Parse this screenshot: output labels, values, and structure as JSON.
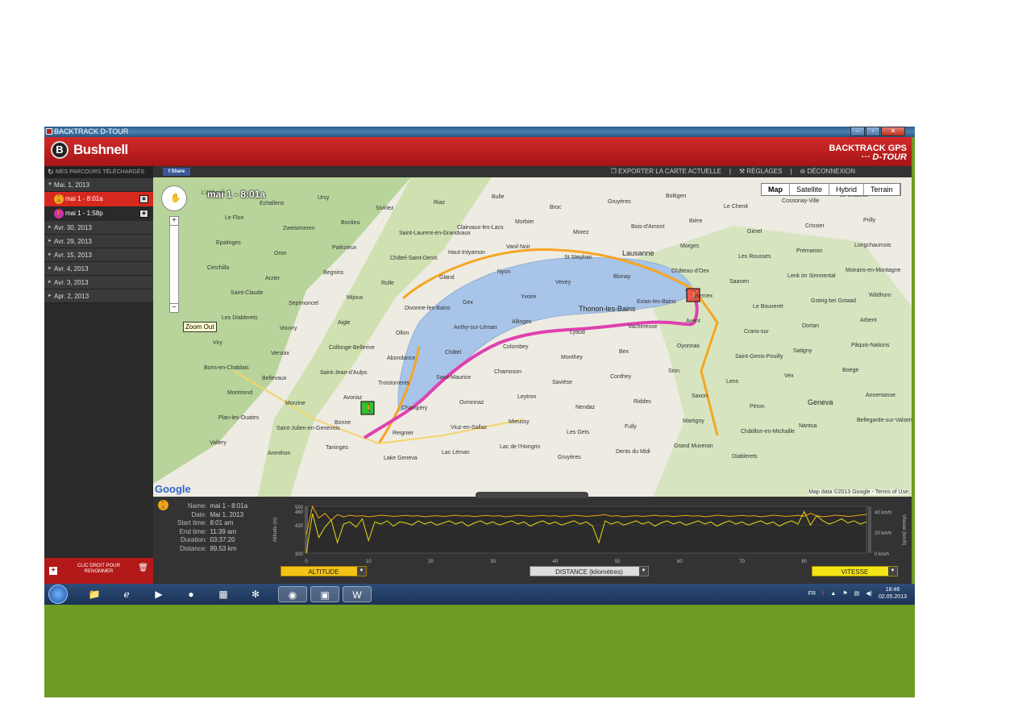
{
  "window": {
    "title": "BACKTRACK D-TOUR"
  },
  "header": {
    "brand": "Bushnell",
    "logo_letter": "B",
    "product_line1": "BACKTRACK GPS",
    "product_line2": "··· D-TOUR"
  },
  "sidebar": {
    "title": "MES PARCOURS TÉLÉCHARGÉS",
    "open_date": "Mai. 1, 2013",
    "tracks": [
      {
        "label": "mai 1 - 8:01a",
        "selected": true,
        "icon_color": "#f3a517"
      },
      {
        "label": "mai 1 - 1:58p",
        "selected": false,
        "icon_color": "#d42fa5"
      }
    ],
    "dates": [
      "Avr. 30, 2013",
      "Avr. 29, 2013",
      "Avr. 15, 2013",
      "Avr. 4, 2013",
      "Avr. 3, 2013",
      "Apr. 2, 2013"
    ],
    "footer_line1": "CLIC DROIT POUR",
    "footer_line2": "RENOMMER"
  },
  "toolbar": {
    "share": "f Share",
    "export": "EXPORTER LA CARTE ACTUELLE",
    "settings": "RÉGLAGES",
    "logout": "DÉCONNEXION"
  },
  "map": {
    "track_name": "mai 1 - 8:01a",
    "types": [
      "Map",
      "Satellite",
      "Hybrid",
      "Terrain"
    ],
    "active_type": "Map",
    "zoom_tooltip": "Zoom Out",
    "google": "Google",
    "attribution": "Map data ©2013 Google - Terms of Use",
    "labels": [
      "L'Abbaye",
      "Echallens",
      "Ursy",
      "Siviriez",
      "Riaz",
      "Bulle",
      "Broc",
      "Gruyères",
      "Boltigen",
      "Le Chenit",
      "Cossonay-Ville",
      "Le Brassus",
      "Le Flon",
      "Zweisimmen",
      "Bonlieu",
      "Saint-Laurent-en-Grandvaux",
      "Clairvaux-les-Lacs",
      "Morbier",
      "Morez",
      "Bois-d'Amont",
      "Bière",
      "Gimel",
      "Crissier",
      "Prilly",
      "Epalinges",
      "Oron",
      "Palézieux",
      "Châtel-Saint-Denis",
      "Haut-Intyamon",
      "Vanil Noir",
      "St Stephan",
      "Lausanne",
      "Morges",
      "Les Rousses",
      "Prémanon",
      "Longchaumois",
      "Cerchilla",
      "Arzier",
      "Begnins",
      "Rolle",
      "Gland",
      "Nyon",
      "Vevey",
      "Blonay",
      "Château-d'Oex",
      "Saanen",
      "Lenk im Simmental",
      "Moirans-en-Montagne",
      "Saint-Claude",
      "Septmoncel",
      "Mijoux",
      "Divonne-les-Bains",
      "Gex",
      "Yvoire",
      "Thonon-les-Bains",
      "Evian-les-Bains",
      "Bernex",
      "Le Bouveret",
      "Gsteig bei Gstaad",
      "Wildhorn",
      "Les Diablerets",
      "Vouvry",
      "Aigle",
      "Ollon",
      "Anthy-sur-Léman",
      "Allinges",
      "Lyaud",
      "Vacheresse",
      "Ayent",
      "Crans-sur",
      "Dortan",
      "Arbent",
      "Viry",
      "Versoix",
      "Collonge-Bellerive",
      "Abondance",
      "Châtel",
      "Colombey",
      "Monthey",
      "Bex",
      "Oyonnax",
      "Saint-Genis-Pouilly",
      "Satigny",
      "Pâquis-Nations",
      "Bons-en-Chablais",
      "Bellevaux",
      "Saint-Jean-d'Aulps",
      "Troistorrents",
      "Saint-Maurice",
      "Chamoson",
      "Savièse",
      "Conthey",
      "Sion",
      "Lens",
      "Vex",
      "Boëge",
      "Montriond",
      "Morzine",
      "Avoriaz",
      "Champéry",
      "Ovronnaz",
      "Leytron",
      "Nendaz",
      "Riddes",
      "Saxon",
      "Péron",
      "Geneva",
      "Annemasse",
      "Plan-les-Ouates",
      "Saint-Julien-en-Genevois",
      "Bonne",
      "Reignier",
      "Viuz-en-Sallaz",
      "Mieussy",
      "Les Gets",
      "Fully",
      "Martigny",
      "Châtillon-en-Michaille",
      "Nantua",
      "Bellegarde-sur-Valserine",
      "Vallery",
      "Arenthon",
      "Taninges",
      "Lake Geneva",
      "Lac Léman",
      "Lac de l'Hongrin",
      "Gruyères",
      "Dents du Midi",
      "Grand Muveran",
      "Diablerets"
    ]
  },
  "info": {
    "name_k": "Name:",
    "name_v": "mai 1 - 8:01a",
    "date_k": "Date:",
    "date_v": "Mai 1, 2013",
    "start_k": "Start time:",
    "start_v": "8:01 am",
    "end_k": "End time:",
    "end_v": "11:39 am",
    "dur_k": "Duration:",
    "dur_v": "03:37:20",
    "dist_k": "Distance:",
    "dist_v": "89.53 km"
  },
  "chart_data": {
    "type": "line",
    "xlabel": "",
    "ylabel": "Altitude (m)",
    "y2label": "Vitesse (km/h)",
    "xlim": [
      0,
      90
    ],
    "x_ticks": [
      "0",
      "10",
      "20",
      "30",
      "40",
      "50",
      "60",
      "70",
      "80"
    ],
    "y_ticks": [
      "300",
      "420",
      "480",
      "500"
    ],
    "y2_ticks": [
      "0 km/h",
      "20 km/h",
      "40 km/h"
    ],
    "series": [
      {
        "name": "Altitude",
        "color": "#f3a517",
        "values": [
          380,
          500,
          450,
          470,
          440,
          465,
          455,
          462,
          458,
          460,
          455,
          458,
          462,
          460,
          457,
          459,
          461,
          458,
          460,
          455,
          458,
          460,
          457,
          459,
          462,
          458,
          460,
          456,
          459,
          461,
          458,
          460,
          455,
          458,
          462,
          460,
          457,
          459,
          461,
          458,
          460,
          455,
          458,
          462,
          460,
          457,
          459,
          461,
          465,
          458,
          460,
          455,
          458,
          460,
          457,
          459,
          462,
          458,
          460,
          456,
          459,
          461,
          458,
          460,
          455,
          458,
          462,
          460,
          457,
          459,
          461,
          458,
          460,
          455,
          458,
          462,
          460,
          457,
          459,
          461,
          458,
          470,
          460,
          455,
          458,
          462,
          460,
          457,
          459,
          463,
          465
        ]
      },
      {
        "name": "Vitesse",
        "color": "#e7d813",
        "values": [
          0,
          38,
          15,
          25,
          32,
          10,
          28,
          30,
          25,
          33,
          12,
          30,
          28,
          31,
          26,
          30,
          29,
          27,
          31,
          28,
          30,
          27,
          29,
          31,
          28,
          30,
          26,
          29,
          31,
          28,
          30,
          27,
          29,
          31,
          28,
          30,
          26,
          29,
          31,
          28,
          30,
          27,
          29,
          31,
          28,
          30,
          26,
          10,
          31,
          28,
          30,
          27,
          29,
          31,
          28,
          30,
          26,
          29,
          31,
          28,
          30,
          27,
          29,
          31,
          28,
          30,
          26,
          29,
          31,
          28,
          30,
          27,
          29,
          31,
          28,
          30,
          26,
          29,
          31,
          28,
          40,
          27,
          36,
          31,
          28,
          30,
          33,
          29,
          31,
          28,
          30
        ]
      }
    ]
  },
  "chart_buttons": {
    "altitude": "ALTITUDE",
    "distance": "DISTANCE (kilomètres)",
    "speed": "VITESSE"
  },
  "taskbar": {
    "apps": [
      "explorer",
      "ie",
      "media",
      "firefox",
      "excel",
      "app",
      "backtrack",
      "bushnell",
      "word"
    ],
    "lang": "FR",
    "time": "18:46",
    "date": "02.05.2013"
  },
  "colors": {
    "brand_red": "#c41e1e",
    "track_pink": "#e040b0",
    "route_orange": "#f5a623",
    "lake": "#a8c4e8"
  }
}
